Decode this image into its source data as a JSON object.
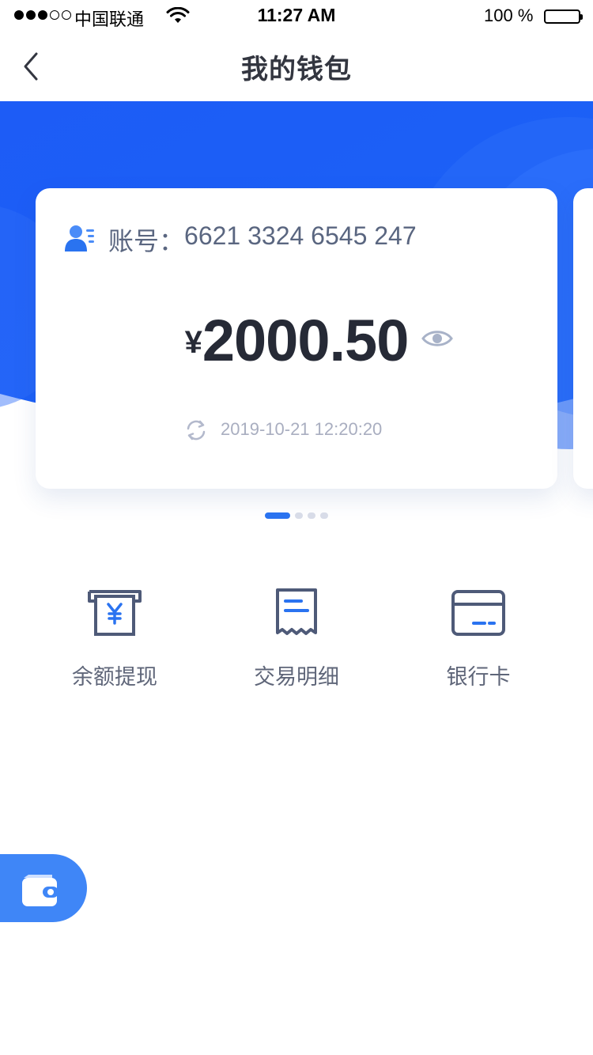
{
  "status_bar": {
    "carrier": "中国联通",
    "time": "11:27 AM",
    "battery": "100 %",
    "battery_level": 1.0,
    "signal_bars_filled": 3,
    "signal_bars_total": 5
  },
  "nav": {
    "title": "我的钱包",
    "back_icon": "chevron-left-icon"
  },
  "colors": {
    "brand_blue": "#1e5ef5",
    "active_dot": "#2a73f0",
    "icon_stroke": "#4e5a78",
    "icon_accent": "#2a73f0"
  },
  "wallet_card": {
    "account_label": "账号：",
    "account_number": "6621 3324 6545 247",
    "currency_symbol": "¥",
    "balance": "2000.50",
    "updated_time": "2019-10-21 12:20:20",
    "account_icon": "user-card-icon",
    "visibility_icon": "eye-icon",
    "refresh_icon": "refresh-icon"
  },
  "pager": {
    "count": 4,
    "active_index": 0
  },
  "actions": [
    {
      "label": "余额提现",
      "icon": "withdraw-icon"
    },
    {
      "label": "交易明细",
      "icon": "receipt-icon"
    },
    {
      "label": "银行卡",
      "icon": "bank-card-icon"
    }
  ],
  "floating_tab": {
    "icon": "wallet-icon"
  }
}
